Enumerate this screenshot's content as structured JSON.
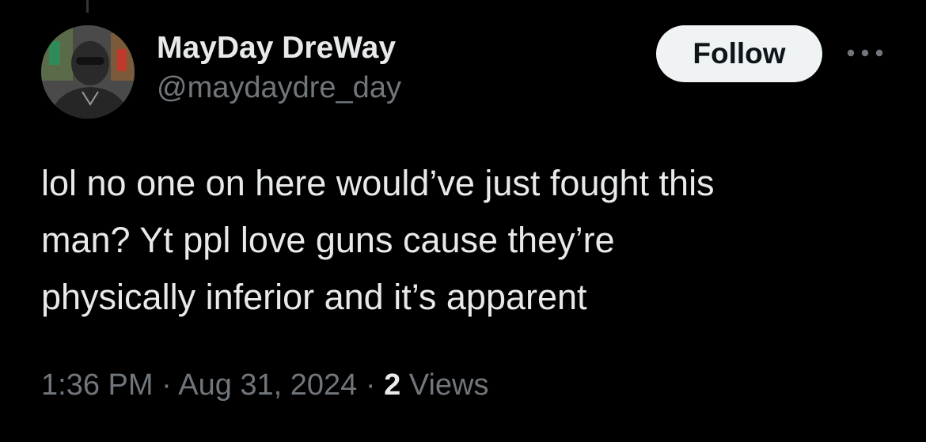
{
  "tweet": {
    "author": {
      "display_name": "MayDay DreWay",
      "handle": "@maydaydre_day",
      "avatar_icon": "profile-photo"
    },
    "follow_label": "Follow",
    "more_icon": "more-horizontal-icon",
    "text_lines": [
      "lol no one on here would’ve just fought this",
      "man? Yt ppl love guns cause they’re",
      "physically inferior and it’s apparent"
    ],
    "time": "1:36 PM",
    "separator": "·",
    "date": "Aug 31, 2024",
    "views_count": "2",
    "views_label": "Views"
  },
  "colors": {
    "background": "#000000",
    "primary_text": "#e7e9ea",
    "secondary_text": "#71767b",
    "follow_bg": "#eff3f4",
    "follow_text": "#0f1419"
  }
}
